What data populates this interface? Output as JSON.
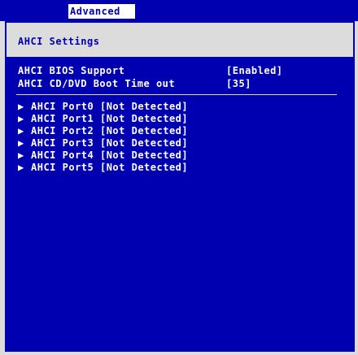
{
  "menu": {
    "active_tab": "Advanced"
  },
  "screen": {
    "title": "AHCI Settings"
  },
  "settings": [
    {
      "label": "AHCI BIOS Support",
      "value": "[Enabled]",
      "selected": true
    },
    {
      "label": "AHCI CD/DVD Boot Time out",
      "value": "[35]",
      "selected": false
    }
  ],
  "ports": [
    {
      "label": "AHCI Port0",
      "status": "[Not Detected]"
    },
    {
      "label": "AHCI Port1",
      "status": "[Not Detected]"
    },
    {
      "label": "AHCI Port2",
      "status": "[Not Detected]"
    },
    {
      "label": "AHCI Port3",
      "status": "[Not Detected]"
    },
    {
      "label": "AHCI Port4",
      "status": "[Not Detected]"
    },
    {
      "label": "AHCI Port5",
      "status": "[Not Detected]"
    }
  ],
  "icons": {
    "submenu_arrow": "triangle-right-icon"
  },
  "colors": {
    "background_blue": "#0000b0",
    "panel_gray": "#dcdcdc",
    "text_white": "#ffffff"
  }
}
